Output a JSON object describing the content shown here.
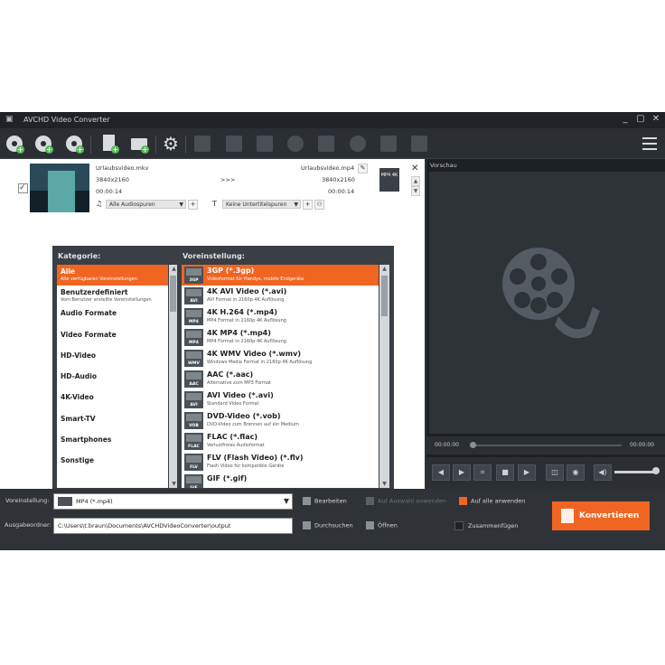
{
  "window": {
    "title": "AVCHD Video Converter",
    "min": "_",
    "max": "▢",
    "close": "✕"
  },
  "file": {
    "source_name": "Urlaubsvideo.mkv",
    "source_res": "3840x2160",
    "source_time": "00:00:14",
    "arrow": ">>>",
    "target_name": "Urlaubsvideo.mp4",
    "target_res": "3840x2160",
    "target_time": "00:00:14",
    "audio_track": "Alle Audiospuren",
    "subtitle_track": "Keine Untertitelspuren",
    "format_badge": "MP4 4K"
  },
  "categories": {
    "label": "Kategorie:",
    "items": [
      {
        "name": "Alle",
        "desc": "Alle verfügbaren Voreinstellungen",
        "selected": true
      },
      {
        "name": "Benutzerdefiniert",
        "desc": "Vom Benutzer erstellte Voreinstellungen"
      },
      {
        "name": "Audio Formate",
        "desc": ""
      },
      {
        "name": "Video Formate",
        "desc": ""
      },
      {
        "name": "HD-Video",
        "desc": ""
      },
      {
        "name": "HD-Audio",
        "desc": ""
      },
      {
        "name": "4K-Video",
        "desc": ""
      },
      {
        "name": "Smart-TV",
        "desc": ""
      },
      {
        "name": "Smartphones",
        "desc": ""
      },
      {
        "name": "Sonstige",
        "desc": ""
      }
    ]
  },
  "presets": {
    "label": "Voreinstellung:",
    "items": [
      {
        "icon": "3GP",
        "name": "3GP (*.3gp)",
        "desc": "Videoformat für Handys, mobile Endgeräte",
        "selected": true
      },
      {
        "icon": "AVI",
        "name": "4K AVI Video (*.avi)",
        "desc": "AVI Format in 2160p 4K Auflösung"
      },
      {
        "icon": "MP4",
        "name": "4K H.264 (*.mp4)",
        "desc": "MP4 Format in 2160p 4K Auflösung"
      },
      {
        "icon": "MP4",
        "name": "4K MP4 (*.mp4)",
        "desc": "MP4 Format in 2160p 4K Auflösung"
      },
      {
        "icon": "WMV",
        "name": "4K WMV Video (*.wmv)",
        "desc": "Windows Media Format in 2160p 4K Auflösung"
      },
      {
        "icon": "AAC",
        "name": "AAC (*.aac)",
        "desc": "Alternative zum MP3 Format"
      },
      {
        "icon": "AVI",
        "name": "AVI Video (*.avi)",
        "desc": "Standard Video Format"
      },
      {
        "icon": "VOB",
        "name": "DVD-Video (*.vob)",
        "desc": "DVD-Video zum Brennen auf ein Medium"
      },
      {
        "icon": "FLAC",
        "name": "FLAC (*.flac)",
        "desc": "Verlustfreies Audioformat"
      },
      {
        "icon": "FLV",
        "name": "FLV (Flash Video) (*.flv)",
        "desc": "Flash Video für kompatible Geräte"
      },
      {
        "icon": "GIF",
        "name": "GIF (*.gif)",
        "desc": ""
      }
    ]
  },
  "preview": {
    "label": "Vorschau",
    "time_current": "00:00:00",
    "time_total": "00:00:00",
    "progress": 0
  },
  "bottom": {
    "preset_label": "Voreinstellung:",
    "preset_value": "MP4 (*.mp4)",
    "output_label": "Ausgabeordner:",
    "output_value": "C:\\Users\\t.braun\\Documents\\AVCHDVideoConverter\\output",
    "edit": "Bearbeiten",
    "apply_selected": "Auf Auswahl anwenden",
    "apply_all": "Auf alle anwenden",
    "browse": "Durchsuchen",
    "open": "Öffnen",
    "merge": "Zusammenfügen",
    "convert": "Konvertieren"
  },
  "colors": {
    "accent": "#f06522",
    "dark": "#2f3337"
  }
}
